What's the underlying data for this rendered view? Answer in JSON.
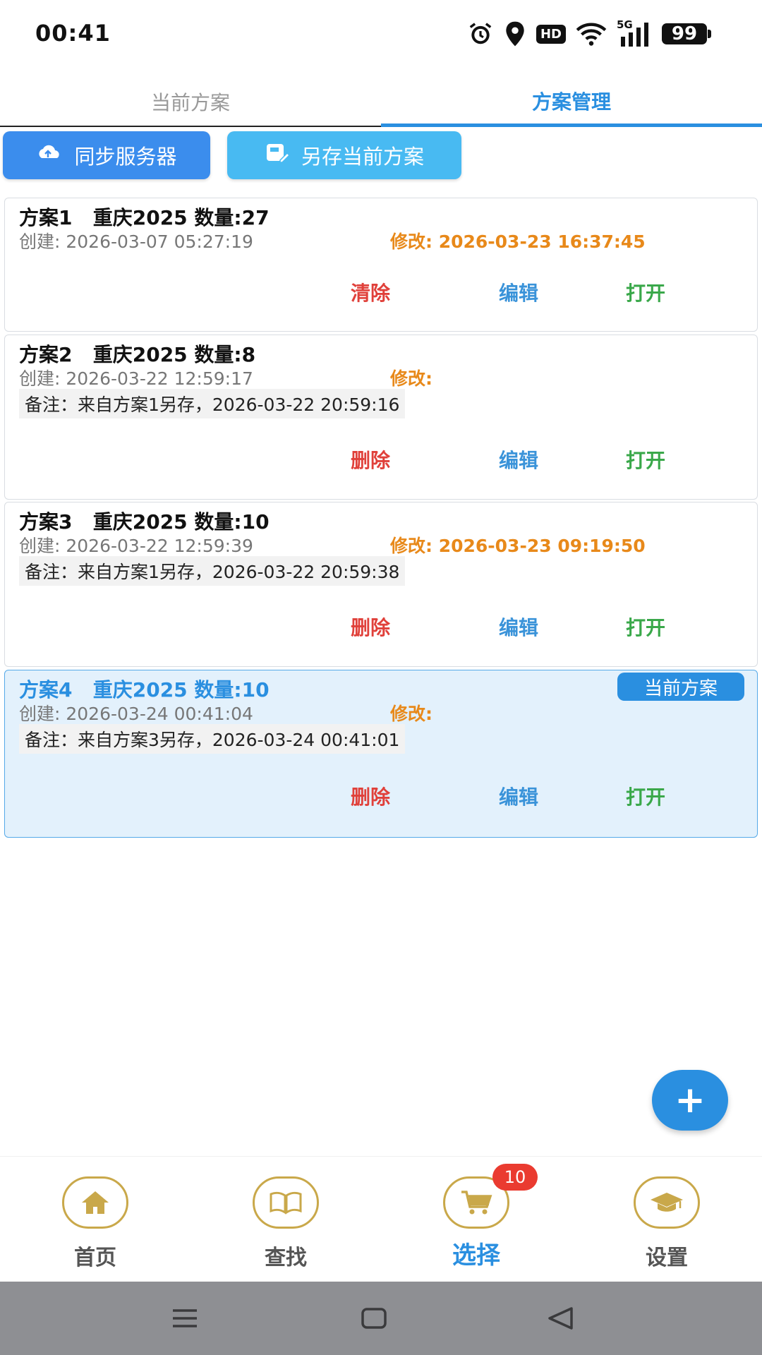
{
  "status_bar": {
    "time": "00:41",
    "icons": [
      "alarm-icon",
      "location-icon",
      "hd-icon",
      "wifi-icon",
      "5g-signal-icon",
      "battery-icon"
    ],
    "hd_label": "HD",
    "network_label": "5G",
    "battery_level": "99"
  },
  "tabs": [
    {
      "label": "当前方案",
      "active": false
    },
    {
      "label": "方案管理",
      "active": true
    }
  ],
  "actions": {
    "sync_label": "同步服务器",
    "saveas_label": "另存当前方案"
  },
  "plans": [
    {
      "title": "方案1   重庆2025 数量:27",
      "created": "创建: 2026-03-07 05:27:19",
      "modified": "修改: 2026-03-23 16:37:45",
      "note": "",
      "delete_label": "清除",
      "edit_label": "编辑",
      "open_label": "打开",
      "current": false
    },
    {
      "title": "方案2   重庆2025 数量:8",
      "created": "创建: 2026-03-22 12:59:17",
      "modified": "修改:",
      "note": "备注：来自方案1另存，2026-03-22 20:59:16",
      "delete_label": "删除",
      "edit_label": "编辑",
      "open_label": "打开",
      "current": false
    },
    {
      "title": "方案3   重庆2025 数量:10",
      "created": "创建: 2026-03-22 12:59:39",
      "modified": "修改: 2026-03-23 09:19:50",
      "note": "备注：来自方案1另存，2026-03-22 20:59:38",
      "delete_label": "删除",
      "edit_label": "编辑",
      "open_label": "打开",
      "current": false
    },
    {
      "title": "方案4   重庆2025 数量:10",
      "created": "创建: 2026-03-24 00:41:04",
      "modified": "修改:",
      "note": "备注：来自方案3另存，2026-03-24 00:41:01",
      "delete_label": "删除",
      "edit_label": "编辑",
      "open_label": "打开",
      "current": true,
      "badge": "当前方案"
    }
  ],
  "fab_label": "+",
  "bottom_nav": [
    {
      "label": "首页",
      "icon": "home-icon",
      "active": false
    },
    {
      "label": "查找",
      "icon": "book-icon",
      "active": false
    },
    {
      "label": "选择",
      "icon": "cart-icon",
      "active": true,
      "badge": "10"
    },
    {
      "label": "设置",
      "icon": "graduation-cap-icon",
      "active": false
    }
  ],
  "colors": {
    "accent": "#2a8fe0",
    "delete": "#e0403a",
    "edit": "#3a93d9",
    "open": "#3aa84a",
    "modified": "#e8891a",
    "gold": "#c9a84a"
  }
}
